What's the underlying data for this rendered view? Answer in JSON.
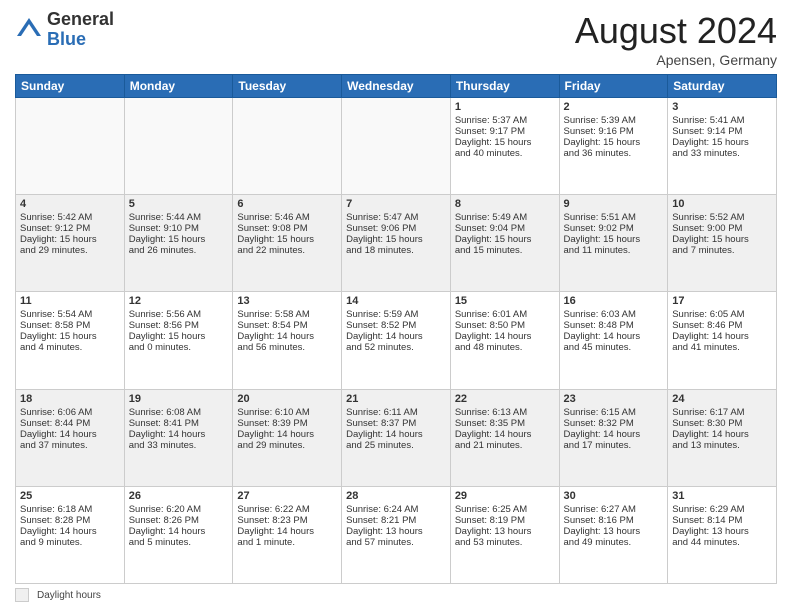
{
  "logo": {
    "general": "General",
    "blue": "Blue"
  },
  "title": "August 2024",
  "location": "Apensen, Germany",
  "days_of_week": [
    "Sunday",
    "Monday",
    "Tuesday",
    "Wednesday",
    "Thursday",
    "Friday",
    "Saturday"
  ],
  "footer_label": "Daylight hours",
  "weeks": [
    [
      {
        "day": "",
        "info": ""
      },
      {
        "day": "",
        "info": ""
      },
      {
        "day": "",
        "info": ""
      },
      {
        "day": "",
        "info": ""
      },
      {
        "day": "1",
        "info": "Sunrise: 5:37 AM\nSunset: 9:17 PM\nDaylight: 15 hours\nand 40 minutes."
      },
      {
        "day": "2",
        "info": "Sunrise: 5:39 AM\nSunset: 9:16 PM\nDaylight: 15 hours\nand 36 minutes."
      },
      {
        "day": "3",
        "info": "Sunrise: 5:41 AM\nSunset: 9:14 PM\nDaylight: 15 hours\nand 33 minutes."
      }
    ],
    [
      {
        "day": "4",
        "info": "Sunrise: 5:42 AM\nSunset: 9:12 PM\nDaylight: 15 hours\nand 29 minutes."
      },
      {
        "day": "5",
        "info": "Sunrise: 5:44 AM\nSunset: 9:10 PM\nDaylight: 15 hours\nand 26 minutes."
      },
      {
        "day": "6",
        "info": "Sunrise: 5:46 AM\nSunset: 9:08 PM\nDaylight: 15 hours\nand 22 minutes."
      },
      {
        "day": "7",
        "info": "Sunrise: 5:47 AM\nSunset: 9:06 PM\nDaylight: 15 hours\nand 18 minutes."
      },
      {
        "day": "8",
        "info": "Sunrise: 5:49 AM\nSunset: 9:04 PM\nDaylight: 15 hours\nand 15 minutes."
      },
      {
        "day": "9",
        "info": "Sunrise: 5:51 AM\nSunset: 9:02 PM\nDaylight: 15 hours\nand 11 minutes."
      },
      {
        "day": "10",
        "info": "Sunrise: 5:52 AM\nSunset: 9:00 PM\nDaylight: 15 hours\nand 7 minutes."
      }
    ],
    [
      {
        "day": "11",
        "info": "Sunrise: 5:54 AM\nSunset: 8:58 PM\nDaylight: 15 hours\nand 4 minutes."
      },
      {
        "day": "12",
        "info": "Sunrise: 5:56 AM\nSunset: 8:56 PM\nDaylight: 15 hours\nand 0 minutes."
      },
      {
        "day": "13",
        "info": "Sunrise: 5:58 AM\nSunset: 8:54 PM\nDaylight: 14 hours\nand 56 minutes."
      },
      {
        "day": "14",
        "info": "Sunrise: 5:59 AM\nSunset: 8:52 PM\nDaylight: 14 hours\nand 52 minutes."
      },
      {
        "day": "15",
        "info": "Sunrise: 6:01 AM\nSunset: 8:50 PM\nDaylight: 14 hours\nand 48 minutes."
      },
      {
        "day": "16",
        "info": "Sunrise: 6:03 AM\nSunset: 8:48 PM\nDaylight: 14 hours\nand 45 minutes."
      },
      {
        "day": "17",
        "info": "Sunrise: 6:05 AM\nSunset: 8:46 PM\nDaylight: 14 hours\nand 41 minutes."
      }
    ],
    [
      {
        "day": "18",
        "info": "Sunrise: 6:06 AM\nSunset: 8:44 PM\nDaylight: 14 hours\nand 37 minutes."
      },
      {
        "day": "19",
        "info": "Sunrise: 6:08 AM\nSunset: 8:41 PM\nDaylight: 14 hours\nand 33 minutes."
      },
      {
        "day": "20",
        "info": "Sunrise: 6:10 AM\nSunset: 8:39 PM\nDaylight: 14 hours\nand 29 minutes."
      },
      {
        "day": "21",
        "info": "Sunrise: 6:11 AM\nSunset: 8:37 PM\nDaylight: 14 hours\nand 25 minutes."
      },
      {
        "day": "22",
        "info": "Sunrise: 6:13 AM\nSunset: 8:35 PM\nDaylight: 14 hours\nand 21 minutes."
      },
      {
        "day": "23",
        "info": "Sunrise: 6:15 AM\nSunset: 8:32 PM\nDaylight: 14 hours\nand 17 minutes."
      },
      {
        "day": "24",
        "info": "Sunrise: 6:17 AM\nSunset: 8:30 PM\nDaylight: 14 hours\nand 13 minutes."
      }
    ],
    [
      {
        "day": "25",
        "info": "Sunrise: 6:18 AM\nSunset: 8:28 PM\nDaylight: 14 hours\nand 9 minutes."
      },
      {
        "day": "26",
        "info": "Sunrise: 6:20 AM\nSunset: 8:26 PM\nDaylight: 14 hours\nand 5 minutes."
      },
      {
        "day": "27",
        "info": "Sunrise: 6:22 AM\nSunset: 8:23 PM\nDaylight: 14 hours\nand 1 minute."
      },
      {
        "day": "28",
        "info": "Sunrise: 6:24 AM\nSunset: 8:21 PM\nDaylight: 13 hours\nand 57 minutes."
      },
      {
        "day": "29",
        "info": "Sunrise: 6:25 AM\nSunset: 8:19 PM\nDaylight: 13 hours\nand 53 minutes."
      },
      {
        "day": "30",
        "info": "Sunrise: 6:27 AM\nSunset: 8:16 PM\nDaylight: 13 hours\nand 49 minutes."
      },
      {
        "day": "31",
        "info": "Sunrise: 6:29 AM\nSunset: 8:14 PM\nDaylight: 13 hours\nand 44 minutes."
      }
    ]
  ]
}
